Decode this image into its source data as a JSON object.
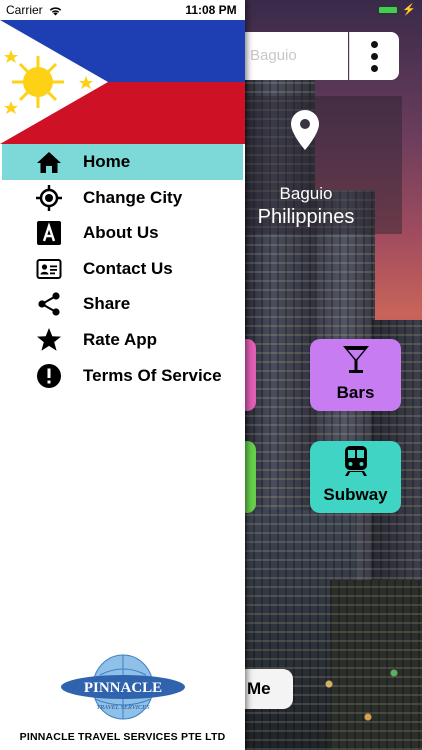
{
  "status_bar": {
    "carrier": "Carrier",
    "time": "11:08 PM"
  },
  "main": {
    "search": {
      "value": "Baguio"
    },
    "location": {
      "city": "Baguio",
      "country": "Philippines"
    },
    "tiles": [
      {
        "label": "Bars",
        "icon": "cocktail-icon",
        "color": "#c77cf2"
      },
      {
        "label": "Subway",
        "icon": "subway-icon",
        "color": "#3fd4c3"
      }
    ],
    "locate_button_partial_label": "Me"
  },
  "drawer": {
    "header_image": "philippines-flag",
    "menu": [
      {
        "label": "Home",
        "icon": "home-icon",
        "active": true
      },
      {
        "label": "Change City",
        "icon": "location-target-icon"
      },
      {
        "label": "About Us",
        "icon": "letter-a-icon"
      },
      {
        "label": "Contact Us",
        "icon": "contact-card-icon"
      },
      {
        "label": "Share",
        "icon": "share-icon"
      },
      {
        "label": "Rate App",
        "icon": "star-icon"
      },
      {
        "label": "Terms Of Service",
        "icon": "info-circle-icon"
      }
    ],
    "logo": {
      "word": "PINNACLE",
      "tagline": "TRAVEL SERVICES"
    },
    "company_name": "PINNACLE TRAVEL SERVICES PTE LTD"
  },
  "colors": {
    "active_item": "#7dd8d8",
    "bars_tile": "#c77cf2",
    "subway_tile": "#3fd4c3",
    "flag_blue": "#1e3fb4",
    "flag_red": "#cf1126",
    "flag_yellow": "#fcd116"
  }
}
